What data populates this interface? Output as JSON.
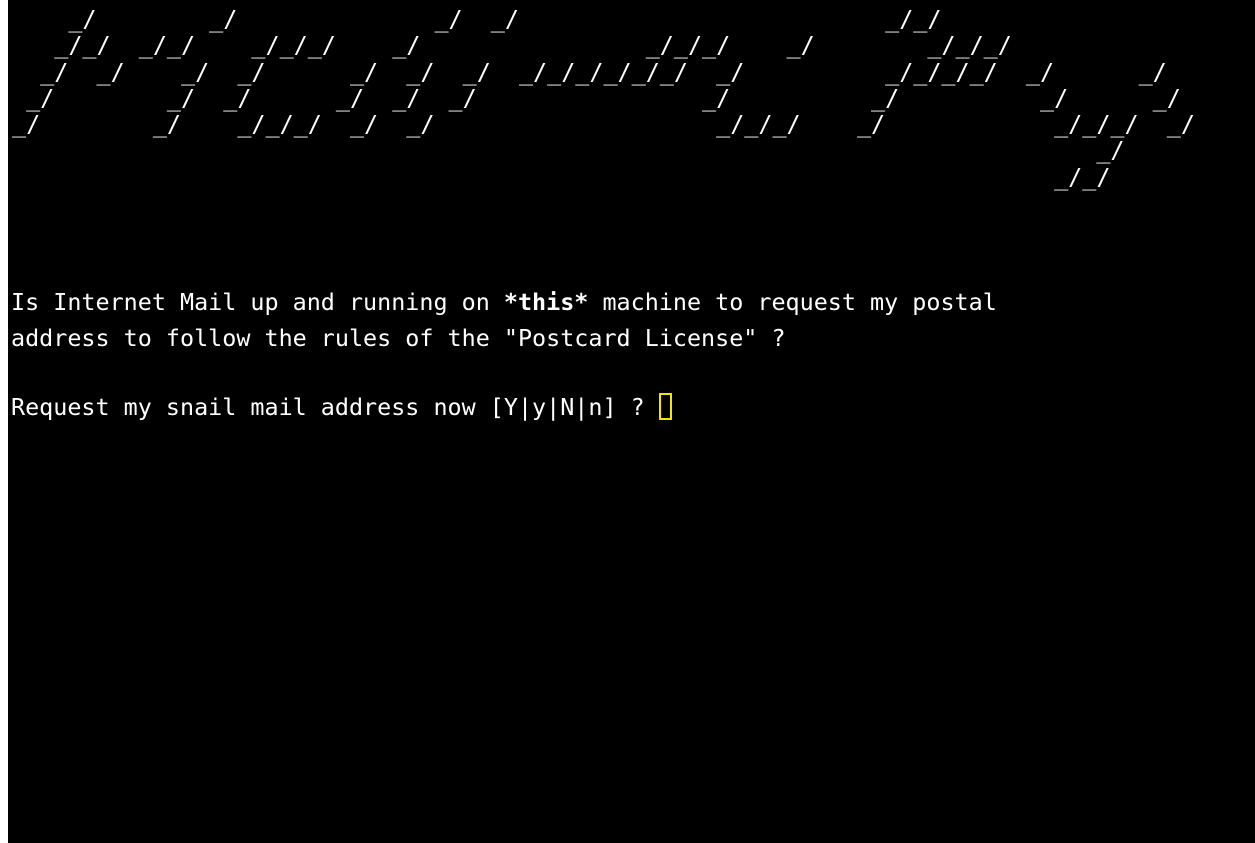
{
  "terminal": {
    "banner_art": "    _/        _/              _/  _/                          _/_/\n   _/_/  _/_/    _/_/_/    _/                _/_/_/    _/        _/_/_/\n  _/  _/    _/  _/      _/  _/  _/  _/_/_/_/_/_/  _/          _/_/_/_/  _/      _/\n _/        _/  _/      _/  _/  _/                _/          _/          _/      _/\n_/        _/    _/_/_/  _/  _/                    _/_/_/    _/            _/_/_/  _/\n                                                                             _/\n                                                                          _/_/",
    "message": {
      "line1_pre": "Is Internet Mail up and running on ",
      "line1_emph": "*this*",
      "line1_post": " machine to request my postal",
      "line2": "address to follow the rules of the \"Postcard License\" ?"
    },
    "prompt": "Request my snail mail address now [Y|y|N|n] ? ",
    "input_value": "",
    "colors": {
      "background": "#000000",
      "foreground": "#ffffff",
      "cursor": "#f5e600"
    }
  }
}
